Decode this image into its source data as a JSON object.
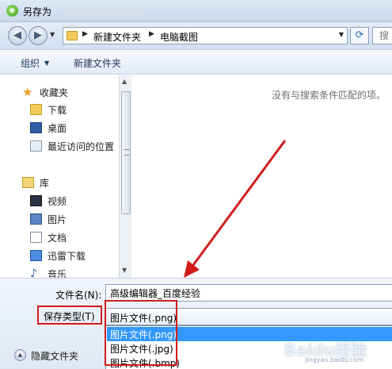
{
  "window": {
    "title": "另存为"
  },
  "address": {
    "crumbs": [
      "新建文件夹",
      "电脑截图"
    ],
    "search_placeholder": "搜"
  },
  "toolbar": {
    "organize": "组织",
    "new_folder": "新建文件夹"
  },
  "nav": {
    "items": [
      {
        "label": "收藏夹",
        "icon": "star-icon"
      },
      {
        "label": "下载",
        "icon": "downloads-folder-icon"
      },
      {
        "label": "桌面",
        "icon": "desktop-icon"
      },
      {
        "label": "最近访问的位置",
        "icon": "recent-places-icon"
      },
      {
        "label": "库",
        "icon": "library-icon"
      },
      {
        "label": "视频",
        "icon": "video-library-icon"
      },
      {
        "label": "图片",
        "icon": "pictures-library-icon"
      },
      {
        "label": "文档",
        "icon": "documents-library-icon"
      },
      {
        "label": "迅雷下载",
        "icon": "xunlei-download-icon"
      },
      {
        "label": "音乐",
        "icon": "music-library-icon"
      }
    ]
  },
  "files": {
    "empty_message": "没有与搜索条件匹配的项。"
  },
  "form": {
    "filename_label": "文件名(N):",
    "filename_value": "高级编辑器_百度经验",
    "type_label": "保存类型(T)",
    "type_value": "图片文件(.png)",
    "type_options": [
      "图片文件(.png)",
      "图片文件(.jpg)",
      "图片文件(.bmp)"
    ],
    "selected_option": "图片文件(.png)"
  },
  "footer": {
    "hide_folders": "隐藏文件夹"
  },
  "watermark": {
    "logo": "Baidu经验",
    "url": "jingyan.baidu.com"
  },
  "colors": {
    "annotation_red": "#d01c1c",
    "selection_blue": "#3399ff"
  }
}
